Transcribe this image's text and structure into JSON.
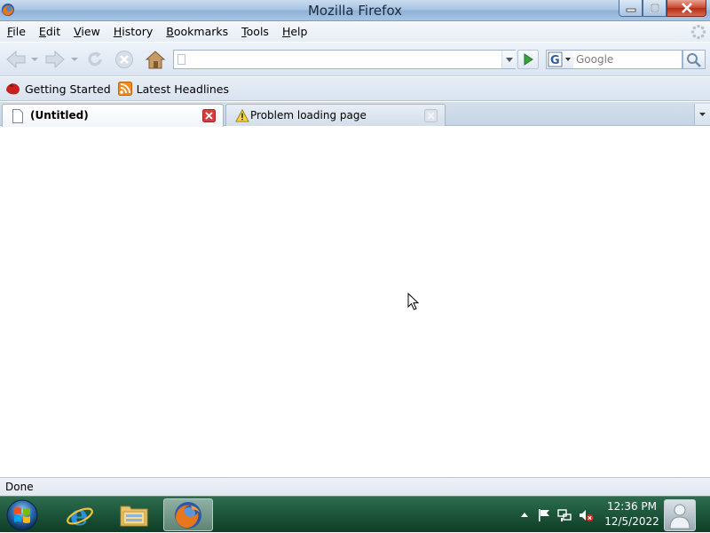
{
  "window": {
    "title": "Mozilla Firefox"
  },
  "menu": [
    {
      "first": "F",
      "rest": "ile"
    },
    {
      "first": "E",
      "rest": "dit"
    },
    {
      "first": "V",
      "rest": "iew"
    },
    {
      "first": "H",
      "rest": "istory"
    },
    {
      "first": "B",
      "rest": "ookmarks"
    },
    {
      "first": "T",
      "rest": "ools"
    },
    {
      "first": "H",
      "rest": "elp"
    }
  ],
  "navbar": {
    "url_value": "",
    "search_placeholder": "Google"
  },
  "bookmarks": [
    {
      "label": "Getting Started",
      "icon": "firefox-icon"
    },
    {
      "label": "Latest Headlines",
      "icon": "rss-feed-icon"
    }
  ],
  "tabs": [
    {
      "label": "(Untitled)",
      "active": true,
      "icon": "blank-page-icon"
    },
    {
      "label": "Problem loading page",
      "active": false,
      "icon": "warning-icon"
    }
  ],
  "status": {
    "text": "Done"
  },
  "taskbar": {
    "time": "12:36 PM",
    "date": "12/5/2022"
  },
  "colors": {
    "taskbar": "#1f5a3e",
    "accent": "#c7442c"
  }
}
